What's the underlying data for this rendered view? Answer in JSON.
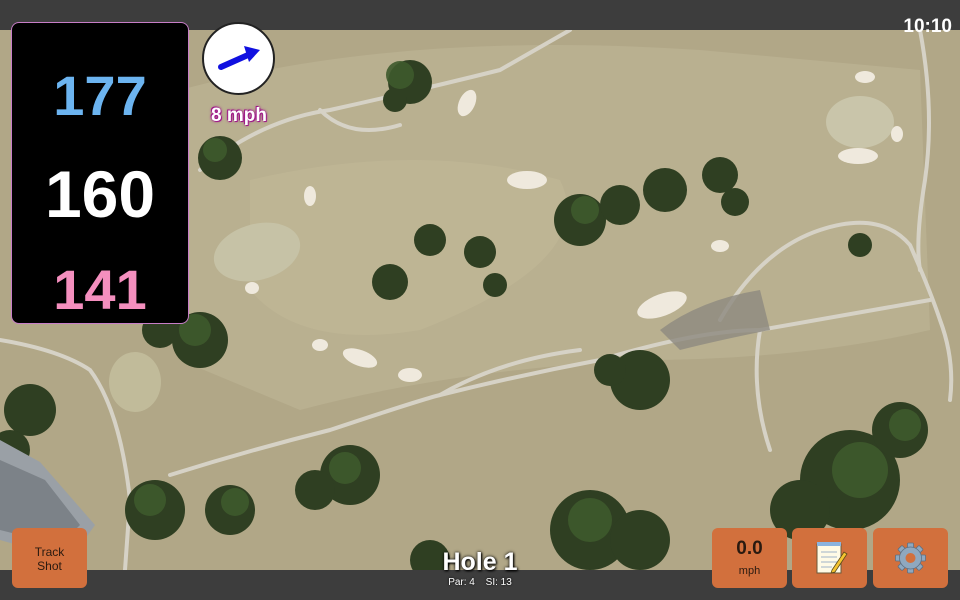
{
  "status_bar": {
    "time": "10:10"
  },
  "yardages": {
    "back": "177",
    "middle": "160",
    "front": "141"
  },
  "wind": {
    "speed": "8 mph",
    "arrow_icon": "arrow-right-icon"
  },
  "buttons": {
    "track_shot_line1": "Track",
    "track_shot_line2": "Shot",
    "speed_value": "0.0",
    "speed_unit": "mph",
    "notes_icon": "notepad-icon",
    "settings_icon": "gear-icon"
  },
  "hole": {
    "title": "Hole 1",
    "par": "Par: 4",
    "si": "SI: 13"
  },
  "colors": {
    "back": "#6cb4f0",
    "middle": "#ffffff",
    "front": "#f48fbe",
    "button": "#d2703d"
  }
}
